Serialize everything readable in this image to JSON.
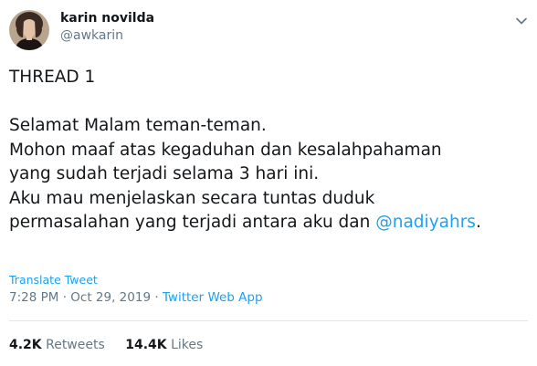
{
  "user": {
    "display_name": "karin novilda",
    "handle": "@awkarin"
  },
  "tweet": {
    "line1": "THREAD 1",
    "line2": "Selamat Malam teman-teman.",
    "line3": "Mohon maaf atas kegaduhan dan kesalahpahaman",
    "line4": "yang sudah terjadi selama 3 hari ini.",
    "line5": "Aku mau menjelaskan secara tuntas duduk",
    "line6_prefix": "permasalahan yang terjadi antara aku dan ",
    "mention": "@nadiyahrs",
    "line6_suffix": "."
  },
  "translate_label": "Translate Tweet",
  "meta": {
    "time": "7:28 PM",
    "sep": " · ",
    "date": "Oct 29, 2019",
    "sep2": " · ",
    "source": "Twitter Web App"
  },
  "stats": {
    "retweets_count": "4.2K",
    "retweets_label": "Retweets",
    "likes_count": "14.4K",
    "likes_label": "Likes"
  },
  "colors": {
    "link": "#1da1f2",
    "secondary": "#657786",
    "text": "#14171a"
  },
  "icons": [
    "avatar-photo",
    "chevron-down-icon"
  ]
}
